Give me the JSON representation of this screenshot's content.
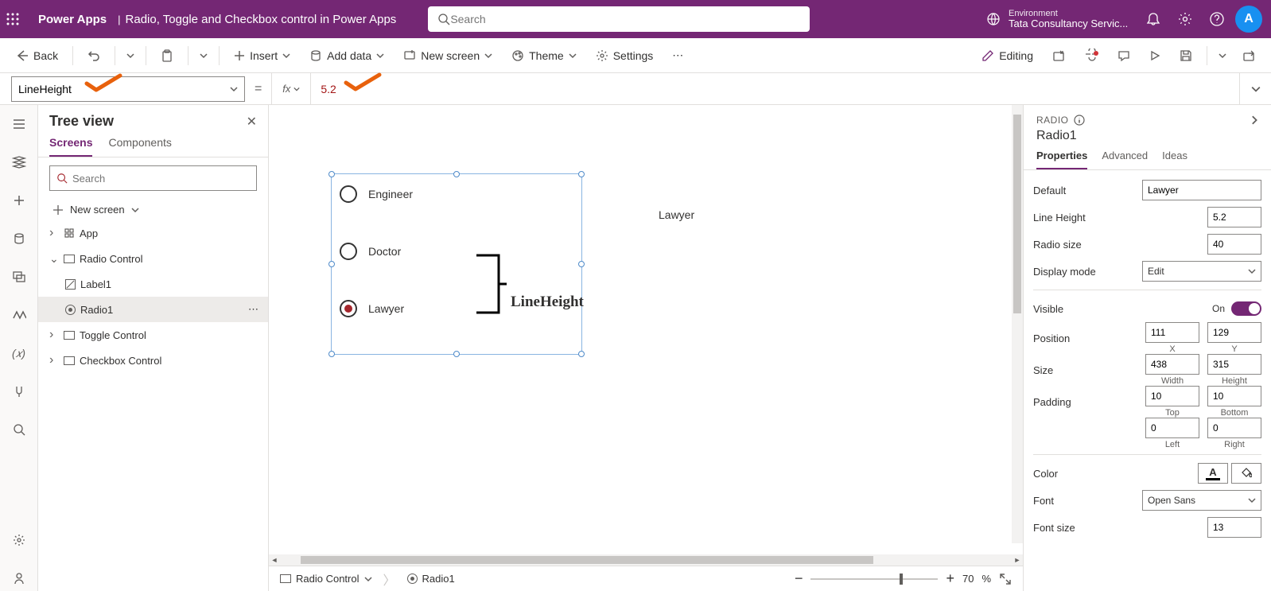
{
  "header": {
    "app": "Power Apps",
    "title": "Radio, Toggle and Checkbox control in Power Apps",
    "searchPlaceholder": "Search",
    "env": {
      "label": "Environment",
      "value": "Tata Consultancy Servic..."
    },
    "avatar": "A"
  },
  "cmdbar": {
    "back": "Back",
    "insert": "Insert",
    "addData": "Add data",
    "newScreen": "New screen",
    "theme": "Theme",
    "settings": "Settings",
    "editing": "Editing"
  },
  "formula": {
    "property": "LineHeight",
    "value": "5.2",
    "fx": "fx"
  },
  "tree": {
    "title": "Tree view",
    "tabs": {
      "screens": "Screens",
      "components": "Components"
    },
    "searchPlaceholder": "Search",
    "newScreen": "New screen",
    "items": {
      "app": "App",
      "radioScreen": "Radio Control",
      "label1": "Label1",
      "radio1": "Radio1",
      "toggleScreen": "Toggle Control",
      "checkboxScreen": "Checkbox Control"
    }
  },
  "canvas": {
    "options": [
      "Engineer",
      "Doctor",
      "Lawyer"
    ],
    "annotation": "LineHeight",
    "labelValue": "Lawyer",
    "breadcrumb": {
      "screen": "Radio Control",
      "control": "Radio1"
    },
    "zoom": "70",
    "zoomPct": "%"
  },
  "props": {
    "type": "RADIO",
    "name": "Radio1",
    "tabs": {
      "properties": "Properties",
      "advanced": "Advanced",
      "ideas": "Ideas"
    },
    "default": {
      "label": "Default",
      "value": "Lawyer"
    },
    "lineHeight": {
      "label": "Line Height",
      "value": "5.2"
    },
    "radioSize": {
      "label": "Radio size",
      "value": "40"
    },
    "displayMode": {
      "label": "Display mode",
      "value": "Edit"
    },
    "visible": {
      "label": "Visible",
      "state": "On"
    },
    "position": {
      "label": "Position",
      "x": "111",
      "y": "129",
      "xl": "X",
      "yl": "Y"
    },
    "size": {
      "label": "Size",
      "w": "438",
      "h": "315",
      "wl": "Width",
      "hl": "Height"
    },
    "padding": {
      "label": "Padding",
      "t": "10",
      "b": "10",
      "l": "0",
      "r": "0",
      "tl": "Top",
      "bl": "Bottom",
      "ll": "Left",
      "rl": "Right"
    },
    "color": {
      "label": "Color"
    },
    "font": {
      "label": "Font",
      "value": "Open Sans"
    },
    "fontSize": {
      "label": "Font size",
      "value": "13"
    }
  }
}
